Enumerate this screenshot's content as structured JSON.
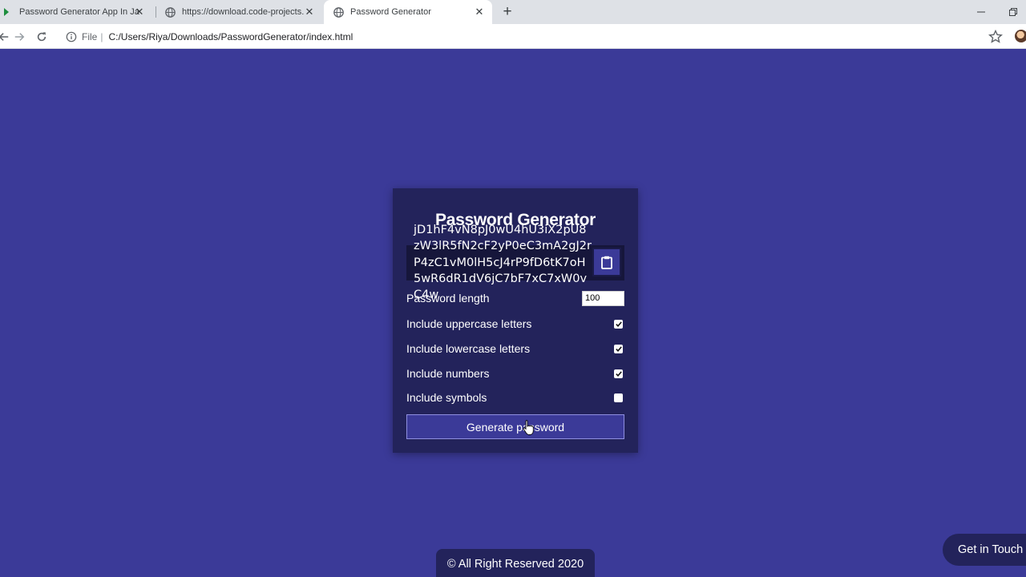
{
  "browser": {
    "tabs": [
      {
        "title": "Password Generator App In JavaScript",
        "active": false
      },
      {
        "title": "https://download.code-projects.org",
        "active": false
      },
      {
        "title": "Password Generator",
        "active": true
      }
    ],
    "address": {
      "scheme_label": "File",
      "divider": "|",
      "url": "C:/Users/Riya/Downloads/PasswordGenerator/index.html"
    }
  },
  "app": {
    "title": "Password Generator",
    "generated_password": "jD1hF4vN8pJ0wU4hU3iX2pU8zW3lR5fN2cF2yP0eC3mA2gJ2rP4zC1vM0lH5cJ4rP9fD6tK7oH5wR6dR1dV6jC7bF7xC7xW0vC4w",
    "settings": {
      "length_label": "Password length",
      "length_value": "100",
      "uppercase_label": "Include uppercase letters",
      "uppercase_checked": true,
      "lowercase_label": "Include lowercase letters",
      "lowercase_checked": true,
      "numbers_label": "Include numbers",
      "numbers_checked": true,
      "symbols_label": "Include symbols",
      "symbols_checked": false
    },
    "generate_label": "Generate password"
  },
  "footer": {
    "text": "© All Right Reserved 2020"
  },
  "contact": {
    "label": "Get in Touch"
  },
  "colors": {
    "page_bg": "#3b3a98",
    "card_bg": "#23235b"
  }
}
